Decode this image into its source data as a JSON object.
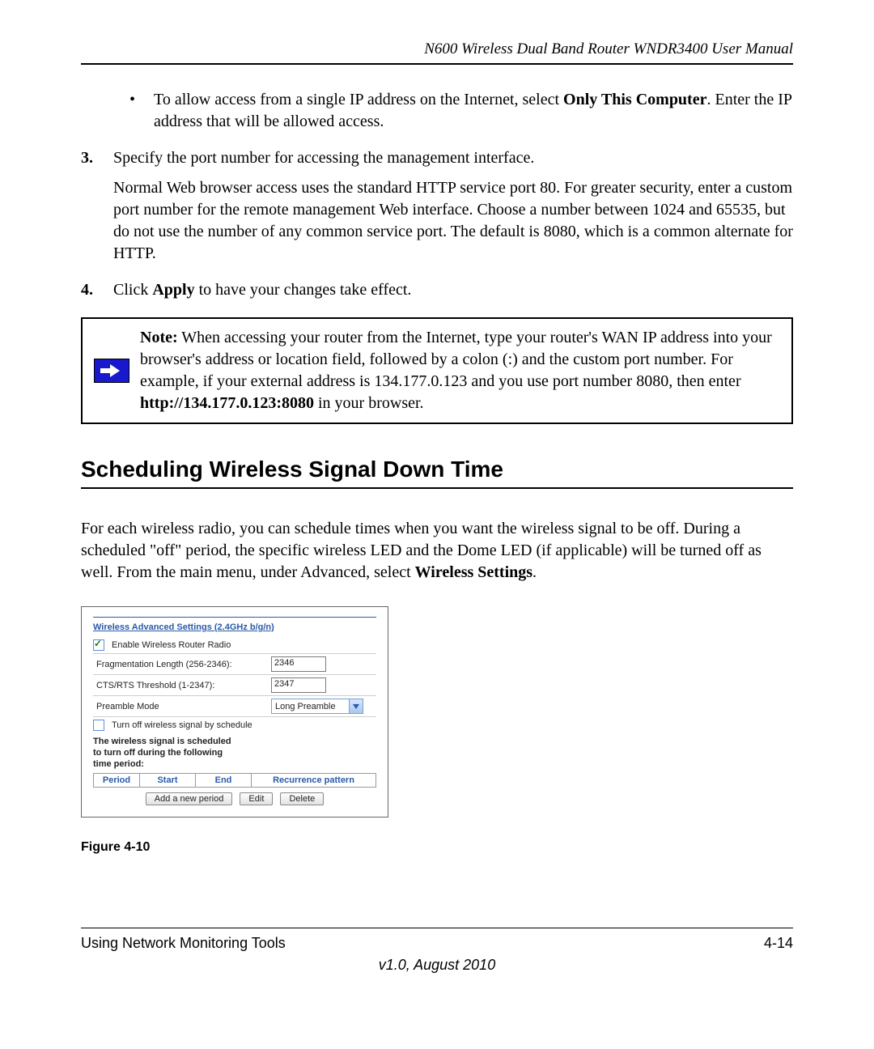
{
  "header": {
    "title": "N600 Wireless Dual Band Router WNDR3400 User Manual"
  },
  "bullet": {
    "text_prefix": "To allow access from a single IP address on the Internet, select ",
    "bold": "Only This Computer",
    "text_suffix": ". Enter the IP address that will be allowed access."
  },
  "step3": {
    "num": "3.",
    "lead": "Specify the port number for accessing the management interface.",
    "para": "Normal Web browser access uses the standard HTTP service port 80. For greater security, enter a custom port number for the remote management Web interface. Choose a number between 1024 and 65535, but do not use the number of any common service port. The default is 8080, which is a common alternate for HTTP."
  },
  "step4": {
    "num": "4.",
    "pre": "Click ",
    "bold": "Apply",
    "post": " to have your changes take effect."
  },
  "note": {
    "label": "Note:",
    "body_a": " When accessing your router from the Internet, type your router's WAN IP address into your browser's address or location field, followed by a colon (:) and the custom port number. For example, if your external address is 134.177.0.123 and you use port number 8080, then enter ",
    "url": "http://134.177.0.123:8080",
    "body_b": " in your browser."
  },
  "section_heading": "Scheduling Wireless Signal Down Time",
  "intro": {
    "pre": "For each wireless radio, you can schedule times when you want the wireless signal to be off. During a scheduled \"off\" period, the specific wireless LED and the Dome LED (if applicable) will be turned off as well. From the main menu, under Advanced, select ",
    "bold": "Wireless Settings",
    "post": "."
  },
  "shot": {
    "title": "Wireless Advanced Settings (2.4GHz b/g/n)",
    "rows": {
      "enable": "Enable Wireless Router Radio",
      "frag_label": "Fragmentation Length (256-2346):",
      "frag_value": "2346",
      "cts_label": "CTS/RTS Threshold (1-2347):",
      "cts_value": "2347",
      "preamble_label": "Preamble Mode",
      "preamble_value": "Long Preamble",
      "turnoff": "Turn off wireless signal by schedule"
    },
    "sched_msg_l1": "The wireless signal is scheduled",
    "sched_msg_l2": "to turn off during the following",
    "sched_msg_l3": "time period:",
    "headers": {
      "period": "Period",
      "start": "Start",
      "end": "End",
      "rec": "Recurrence pattern"
    },
    "buttons": {
      "add": "Add a new period",
      "edit": "Edit",
      "del": "Delete"
    }
  },
  "figure_caption": "Figure 4-10",
  "footer": {
    "left": "Using Network Monitoring Tools",
    "right": "4-14",
    "version": "v1.0, August 2010"
  }
}
